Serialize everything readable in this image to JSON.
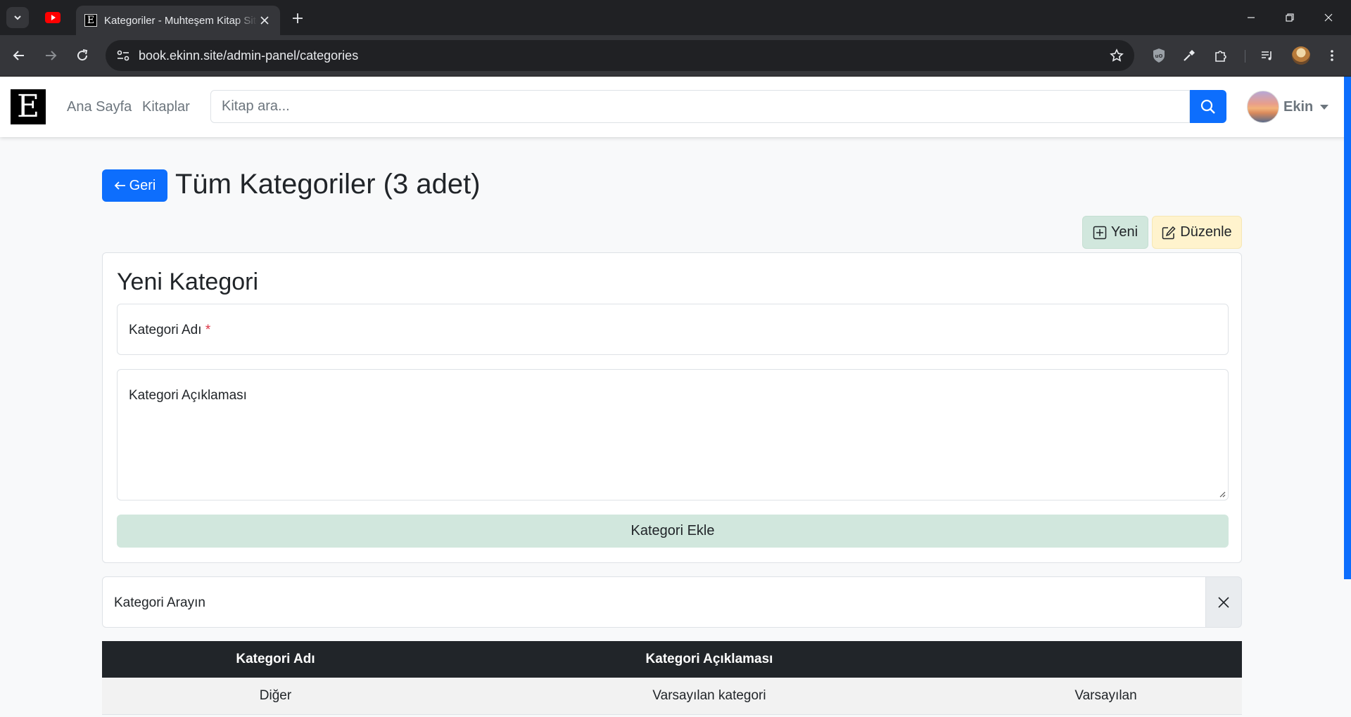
{
  "browser": {
    "tab_title": "Kategoriler - Muhteşem Kitap Sitesi",
    "url": "book.ekinn.site/admin-panel/categories"
  },
  "navbar": {
    "brand": "E",
    "links": [
      "Ana Sayfa",
      "Kitaplar"
    ],
    "search_placeholder": "Kitap ara...",
    "user_name": "Ekin"
  },
  "header": {
    "back_label": "Geri",
    "title": "Tüm Kategoriler (3 adet)"
  },
  "actions": {
    "new_label": "Yeni",
    "edit_label": "Düzenle"
  },
  "form": {
    "title": "Yeni Kategori",
    "name_label": "Kategori Adı",
    "required_mark": "*",
    "description_label": "Kategori Açıklaması",
    "submit_label": "Kategori Ekle"
  },
  "filter": {
    "label": "Kategori Arayın"
  },
  "table": {
    "headers": [
      "Kategori Adı",
      "Kategori Açıklaması",
      ""
    ],
    "rows": [
      [
        "Diğer",
        "Varsayılan kategori",
        "Varsayılan"
      ]
    ]
  },
  "colors": {
    "primary": "#0d6efd",
    "success_subtle": "#d1e7dd",
    "warning_subtle": "#fff3cd",
    "dark": "#212529"
  }
}
